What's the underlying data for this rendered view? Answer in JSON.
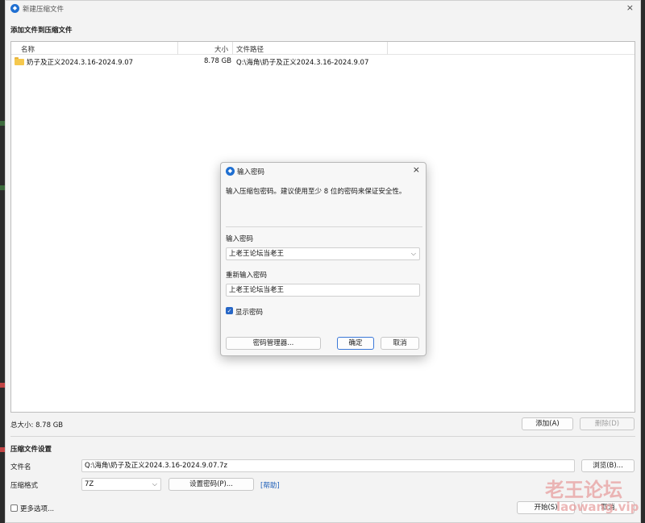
{
  "window": {
    "title": "新建压缩文件",
    "icon": "app-logo-icon",
    "close_glyph": "×"
  },
  "files_section": {
    "title": "添加文件到压缩文件",
    "columns": [
      "名称",
      "大小",
      "文件路径"
    ],
    "rows": [
      {
        "name": "奶子及正义2024.3.16-2024.9.07",
        "size": "8.78 GB",
        "path": "Q:\\海角\\奶子及正义2024.3.16-2024.9.07",
        "icon": "folder-icon"
      }
    ],
    "total_size": "总大小: 8.78 GB",
    "add_button": "添加(A)",
    "delete_button": "删除(D)"
  },
  "settings": {
    "title": "压缩文件设置",
    "filename_label": "文件名",
    "filename_value": "Q:\\海角\\奶子及正义2024.3.16-2024.9.07.7z",
    "browse_button": "浏览(B)...",
    "format_label": "压缩格式",
    "format_value": "7Z",
    "set_password_button": "设置密码(P)...",
    "help_link": "[帮助]",
    "more_options_label": "更多选项...",
    "start_button": "开始(S)",
    "cancel_button": "取消"
  },
  "dialog": {
    "title": "输入密码",
    "close_glyph": "×",
    "message": "输入压缩包密码。建议使用至少 8 位的密码来保证安全性。",
    "password_label": "输入密码",
    "password_value": "上老王论坛当老王",
    "confirm_label": "重新输入密码",
    "confirm_value": "上老王论坛当老王",
    "show_password_label": "显示密码",
    "show_password_checked": true,
    "manager_button": "密码管理器...",
    "ok_button": "确定",
    "cancel_button": "取消"
  },
  "watermark": {
    "line1": "老王论坛",
    "line2": "laowang.vip"
  },
  "colors": {
    "accent": "#2666c6",
    "folder": "#f5c84d",
    "link": "#1f5fb8"
  }
}
